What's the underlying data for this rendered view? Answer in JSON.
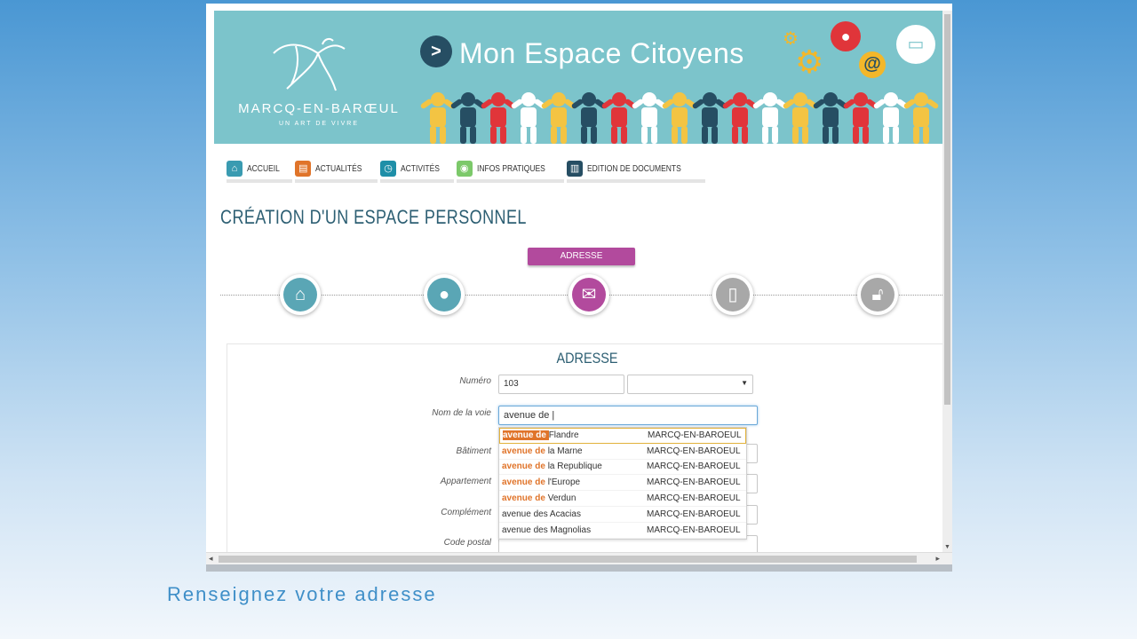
{
  "banner": {
    "logo_name": "MARCQ-EN-BARŒUL",
    "logo_tagline": "UN ART DE VIVRE",
    "app_title": "Mon Espace Citoyens"
  },
  "nav": [
    {
      "label": "ACCUEIL",
      "icon": "home-icon",
      "color": "#3a9bb1"
    },
    {
      "label": "ACTUALITÉS",
      "icon": "newspaper-icon",
      "color": "#e0742a"
    },
    {
      "label": "ACTIVITÉS",
      "icon": "clock-icon",
      "color": "#1f8fa8"
    },
    {
      "label": "INFOS PRATIQUES",
      "icon": "lightbulb-icon",
      "color": "#7cc96a"
    },
    {
      "label": "EDITION DE DOCUMENTS",
      "icon": "printer-icon",
      "color": "#264e63"
    }
  ],
  "page_title": "CRÉATION D'UN ESPACE PERSONNEL",
  "wizard": {
    "active_step_label": "ADRESSE",
    "steps": [
      {
        "icon": "home-icon",
        "color": "#5aa6b5",
        "state": "done"
      },
      {
        "icon": "user-icon",
        "color": "#5aa6b5",
        "state": "done"
      },
      {
        "icon": "envelope-icon",
        "color": "#b24a9d",
        "state": "active"
      },
      {
        "icon": "phone-icon",
        "color": "#a8a8a8",
        "state": "pending"
      },
      {
        "icon": "lock-icon",
        "color": "#a8a8a8",
        "state": "pending"
      }
    ]
  },
  "form": {
    "title": "ADRESSE",
    "numero_label": "Numéro",
    "numero_value": "103",
    "voie_label": "Nom de la voie",
    "voie_value": "avenue de |",
    "batiment_label": "Bâtiment",
    "appartement_label": "Appartement",
    "complement_label": "Complément",
    "code_postal_label": "Code postal"
  },
  "suggestions": [
    {
      "match": "avenue de ",
      "rest": "Flandre",
      "city": "MARCQ-EN-BAROEUL"
    },
    {
      "match": "avenue de ",
      "rest": "la Marne",
      "city": "MARCQ-EN-BAROEUL"
    },
    {
      "match": "avenue de ",
      "rest": "la Republique",
      "city": "MARCQ-EN-BAROEUL"
    },
    {
      "match": "avenue de ",
      "rest": "l'Europe",
      "city": "MARCQ-EN-BAROEUL"
    },
    {
      "match": "avenue de ",
      "rest": "Verdun",
      "city": "MARCQ-EN-BAROEUL"
    },
    {
      "match": "",
      "rest": "avenue des Acacias",
      "city": "MARCQ-EN-BAROEUL"
    },
    {
      "match": "",
      "rest": "avenue des Magnolias",
      "city": "MARCQ-EN-BAROEUL"
    }
  ],
  "caption": "Renseignez votre adresse"
}
